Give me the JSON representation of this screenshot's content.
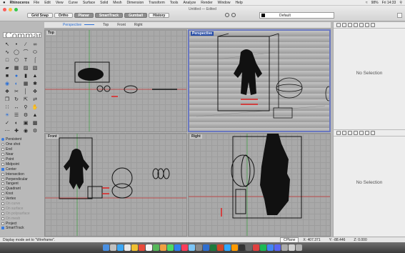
{
  "menubar": {
    "app": "Rhinoceros",
    "items": [
      "File",
      "Edit",
      "View",
      "Curve",
      "Surface",
      "Solid",
      "Mesh",
      "Dimension",
      "Transform",
      "Tools",
      "Analyze",
      "Render",
      "Window",
      "Help"
    ],
    "battery": "98%",
    "clock": "Fri 14:33"
  },
  "window": {
    "title": "Untitled — Edited",
    "toggles": [
      {
        "label": "Grid Snap",
        "on": false
      },
      {
        "label": "Ortho",
        "on": false
      },
      {
        "label": "Planar",
        "on": true
      },
      {
        "label": "SmartTrack",
        "on": true
      },
      {
        "label": "Gumball",
        "on": true
      },
      {
        "label": "History",
        "on": false
      }
    ],
    "layer": "Default"
  },
  "command": {
    "placeholder": "Command"
  },
  "viewport_tabs": [
    "Perspective",
    "Top",
    "Front",
    "Right"
  ],
  "viewports": {
    "top": "Top",
    "perspective": "Perspective",
    "front": "Front",
    "right": "Right"
  },
  "osnaps": [
    {
      "label": "Persistent",
      "kind": "radio",
      "checked": true
    },
    {
      "label": "One shot",
      "kind": "radio",
      "checked": false
    },
    {
      "label": "End",
      "kind": "check",
      "checked": false
    },
    {
      "label": "Near",
      "kind": "check",
      "checked": false
    },
    {
      "label": "Point",
      "kind": "check",
      "checked": false
    },
    {
      "label": "Midpoint",
      "kind": "check",
      "checked": false
    },
    {
      "label": "Center",
      "kind": "check",
      "checked": true
    },
    {
      "label": "Intersection",
      "kind": "check",
      "checked": false
    },
    {
      "label": "Perpendicular",
      "kind": "check",
      "checked": false
    },
    {
      "label": "Tangent",
      "kind": "check",
      "checked": false
    },
    {
      "label": "Quadrant",
      "kind": "check",
      "checked": false
    },
    {
      "label": "Knot",
      "kind": "check",
      "checked": false
    },
    {
      "label": "Vertex",
      "kind": "check",
      "checked": false
    },
    {
      "label": "On curve",
      "kind": "check",
      "checked": false,
      "dim": true
    },
    {
      "label": "On surface",
      "kind": "check",
      "checked": false,
      "dim": true
    },
    {
      "label": "On polysurface",
      "kind": "check",
      "checked": false,
      "dim": true
    },
    {
      "label": "On mesh",
      "kind": "check",
      "checked": false,
      "dim": true
    },
    {
      "label": "Project",
      "kind": "check",
      "checked": false
    },
    {
      "label": "SmartTrack",
      "kind": "check",
      "checked": true
    }
  ],
  "panels": {
    "top_status": "No Selection",
    "bottom_status": "No Selection"
  },
  "status": {
    "message": "Display mode set to \"Wireframe\".",
    "cplane": "CPlane",
    "x": "X: 407.371",
    "y": "Y: -88.446",
    "z": "Z: 0.000"
  },
  "colors": {
    "accent": "#2a6fd6",
    "selection": "#e02020",
    "axis_x": "#c83030",
    "axis_y": "#3aa040"
  }
}
